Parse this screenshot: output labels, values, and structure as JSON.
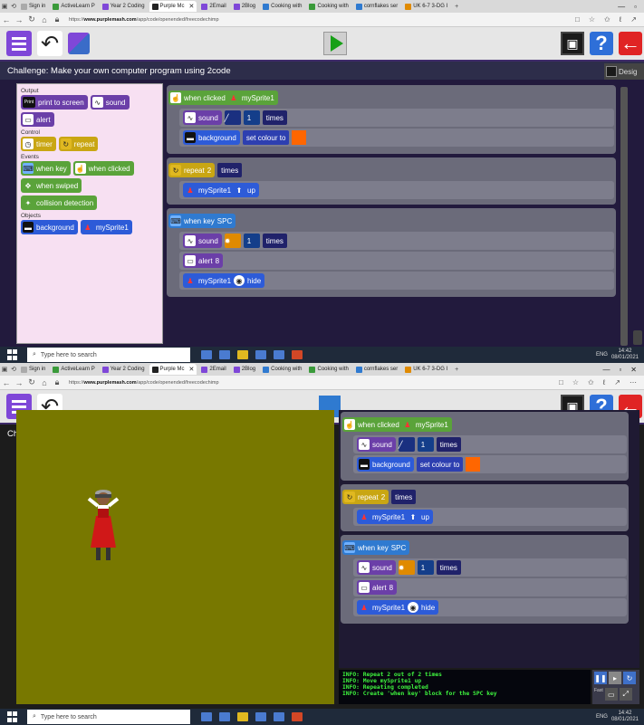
{
  "browser": {
    "tabs": [
      {
        "label": "Sign in",
        "active": false
      },
      {
        "label": "ActiveLearn P",
        "active": false
      },
      {
        "label": "Year 2 Coding",
        "active": false
      },
      {
        "label": "Purple Mc",
        "active": true
      },
      {
        "label": "2Email",
        "active": false
      },
      {
        "label": "2Blog",
        "active": false
      },
      {
        "label": "Cooking with",
        "active": false
      },
      {
        "label": "Cooking with",
        "active": false
      },
      {
        "label": "cornflakes ser",
        "active": false
      },
      {
        "label": "UK 6-7 3-DG I",
        "active": false
      }
    ],
    "url_prefix": "https://",
    "url_domain": "www.purplemash.com",
    "url_path": "/app/code/openended/freecodechimp"
  },
  "challenge": "Challenge: Make your own computer program using 2code",
  "design_label": "Desig",
  "palette": {
    "output_label": "Output",
    "print": "print to screen",
    "print_icon": "Print",
    "sound": "sound",
    "alert": "alert",
    "control_label": "Control",
    "timer": "timer",
    "repeat": "repeat",
    "events_label": "Events",
    "when_key": "when key",
    "when_clicked": "when clicked",
    "when_swiped": "when swiped",
    "collision": "collision detection",
    "objects_label": "Objects",
    "background": "background",
    "sprite": "mySprite1"
  },
  "code": {
    "g1_head": "when clicked",
    "g1_obj": "mySprite1",
    "g1_sound": "sound",
    "g1_count": "1",
    "g1_times": "times",
    "g1_bg": "background",
    "g1_setcolour": "set colour to",
    "g2_repeat": "repeat",
    "g2_count": "2",
    "g2_times": "times",
    "g2_sprite": "mySprite1",
    "g2_up": "up",
    "g3_head": "when key",
    "g3_key": "SPC",
    "g3_sound": "sound",
    "g3_count": "1",
    "g3_times": "times",
    "g3_alert": "alert",
    "g3_alert_val": "8",
    "g3_sprite": "mySprite1",
    "g3_hide": "hide"
  },
  "console": [
    "INFO: Repeat 2 out of 2 times",
    "INFO: Move mySprite1 up",
    "INFO: Repeating completed",
    "INFO: Create 'when key' block for the SPC key"
  ],
  "speed_label": "Fast",
  "taskbar": {
    "search_placeholder": "Type here to search",
    "time": "14:42",
    "date": "08/01/2021",
    "lang": "ENG"
  },
  "colors": {
    "brand_purple": "#7f47d8",
    "background_colour": "#ff6600",
    "stage": "#787800"
  }
}
